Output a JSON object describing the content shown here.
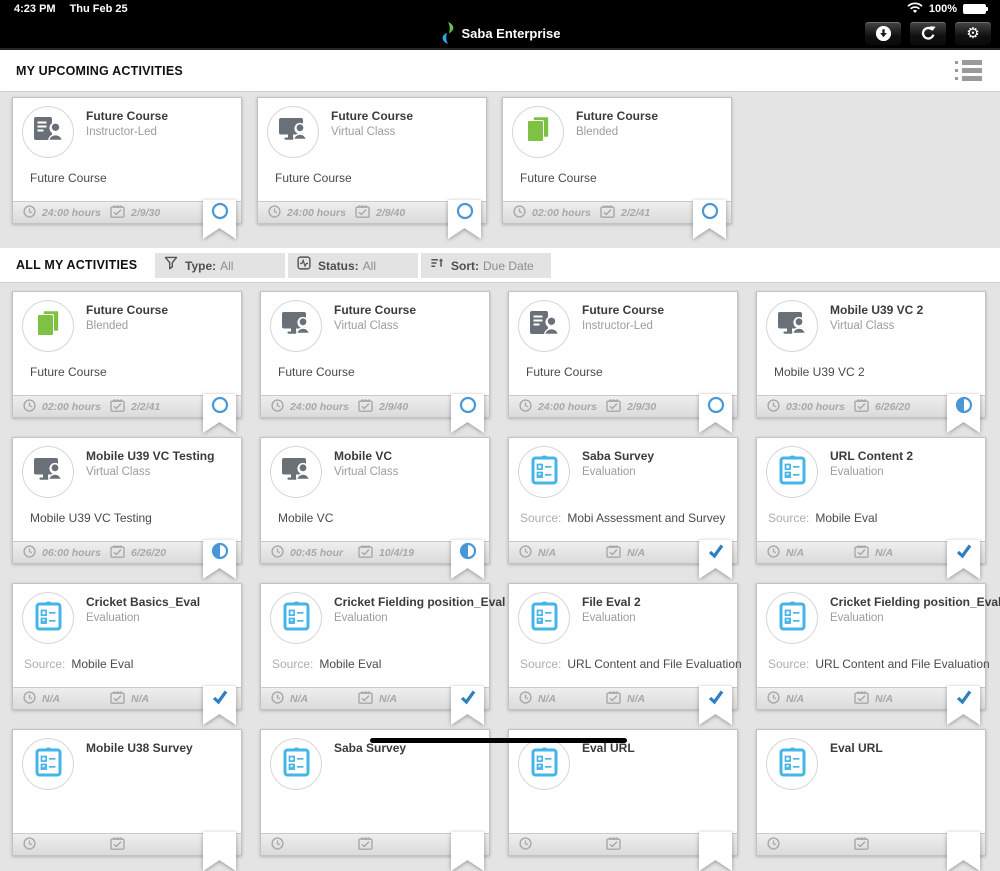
{
  "status_bar": {
    "time": "4:23 PM",
    "date": "Thu Feb 25",
    "battery_label": "100%"
  },
  "nav": {
    "app_title": "Saba Enterprise"
  },
  "sections": {
    "upcoming": {
      "title": "MY UPCOMING ACTIVITIES"
    },
    "all": {
      "title": "ALL MY ACTIVITIES",
      "filters": [
        {
          "icon": "filter-funnel-icon",
          "label": "Type:",
          "value": "All"
        },
        {
          "icon": "status-pulse-icon",
          "label": "Status:",
          "value": "All"
        },
        {
          "icon": "sort-icon",
          "label": "Sort:",
          "value": "Due Date"
        }
      ]
    }
  },
  "colors": {
    "accent_blue": "#4a97d6",
    "check_blue": "#2d7fc1",
    "evaluation_blue": "#45b5e8",
    "blended_green": "#7dc242",
    "course_icon_gray": "#6a7077"
  },
  "labels": {
    "source": "Source:"
  },
  "upcoming_cards": [
    {
      "type": "instructor-led",
      "title": "Future Course",
      "subtitle": "Instructor-Led",
      "body": "Future Course",
      "duration": "24:00 hours",
      "date": "2/9/30",
      "status": "not-started"
    },
    {
      "type": "virtual-class",
      "title": "Future Course",
      "subtitle": "Virtual Class",
      "body": "Future Course",
      "duration": "24:00 hours",
      "date": "2/9/40",
      "status": "not-started"
    },
    {
      "type": "blended",
      "title": "Future Course",
      "subtitle": "Blended",
      "body": "Future Course",
      "duration": "02:00 hours",
      "date": "2/2/41",
      "status": "not-started"
    }
  ],
  "activity_cards": [
    {
      "type": "blended",
      "title": "Future Course",
      "subtitle": "Blended",
      "body": "Future Course",
      "duration": "02:00 hours",
      "date": "2/2/41",
      "status": "not-started"
    },
    {
      "type": "virtual-class",
      "title": "Future Course",
      "subtitle": "Virtual Class",
      "body": "Future Course",
      "duration": "24:00 hours",
      "date": "2/9/40",
      "status": "not-started"
    },
    {
      "type": "instructor-led",
      "title": "Future Course",
      "subtitle": "Instructor-Led",
      "body": "Future Course",
      "duration": "24:00 hours",
      "date": "2/9/30",
      "status": "not-started"
    },
    {
      "type": "virtual-class",
      "title": "Mobile U39 VC 2",
      "subtitle": "Virtual Class",
      "body": "Mobile U39 VC 2",
      "duration": "03:00 hours",
      "date": "6/26/20",
      "status": "in-progress"
    },
    {
      "type": "virtual-class",
      "title": "Mobile U39 VC Testing",
      "subtitle": "Virtual Class",
      "body": "Mobile U39 VC Testing",
      "duration": "06:00 hours",
      "date": "6/26/20",
      "status": "in-progress"
    },
    {
      "type": "virtual-class",
      "title": "Mobile VC",
      "subtitle": "Virtual Class",
      "body": "Mobile VC",
      "duration": "00:45 hour",
      "date": "10/4/19",
      "status": "in-progress"
    },
    {
      "type": "evaluation",
      "title": "Saba Survey",
      "subtitle": "Evaluation",
      "source": "Mobi Assessment and Survey",
      "duration": "N/A",
      "date": "N/A",
      "status": "completed"
    },
    {
      "type": "evaluation",
      "title": "URL Content 2",
      "subtitle": "Evaluation",
      "source": "Mobile Eval",
      "duration": "N/A",
      "date": "N/A",
      "status": "completed"
    },
    {
      "type": "evaluation",
      "title": "Cricket Basics_Eval",
      "subtitle": "Evaluation",
      "source": "Mobile Eval",
      "duration": "N/A",
      "date": "N/A",
      "status": "completed"
    },
    {
      "type": "evaluation",
      "title": "Cricket Fielding position_Eval",
      "subtitle": "Evaluation",
      "source": "Mobile Eval",
      "duration": "N/A",
      "date": "N/A",
      "status": "completed"
    },
    {
      "type": "evaluation",
      "title": "File Eval 2",
      "subtitle": "Evaluation",
      "source": "URL Content and File Evaluation",
      "duration": "N/A",
      "date": "N/A",
      "status": "completed"
    },
    {
      "type": "evaluation",
      "title": "Cricket Fielding position_Eval",
      "subtitle": "Evaluation",
      "source": "URL Content and File Evaluation",
      "duration": "N/A",
      "date": "N/A",
      "status": "completed"
    },
    {
      "type": "evaluation",
      "title": "Mobile U38 Survey",
      "subtitle": "",
      "duration": "",
      "date": "",
      "status": "none"
    },
    {
      "type": "evaluation",
      "title": "Saba Survey",
      "subtitle": "",
      "duration": "",
      "date": "",
      "status": "none"
    },
    {
      "type": "evaluation",
      "title": "Eval URL",
      "subtitle": "",
      "duration": "",
      "date": "",
      "status": "none"
    },
    {
      "type": "evaluation",
      "title": "Eval URL",
      "subtitle": "",
      "duration": "",
      "date": "",
      "status": "none"
    }
  ]
}
